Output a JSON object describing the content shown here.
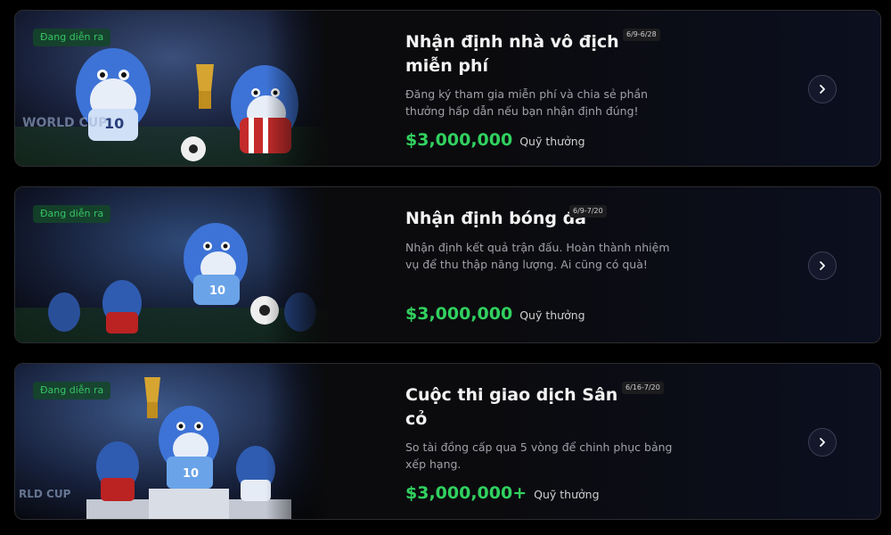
{
  "cards": [
    {
      "status": "Đang diễn ra",
      "title": "Nhận định nhà vô địch miễn phí",
      "date": "6/9-6/28",
      "description": "Đăng ký tham gia miễn phí và chia sẻ phần thưởng hấp dẫn nếu bạn nhận định đúng!",
      "prize_amount": "$3,000,000",
      "prize_label": "Quỹ thưởng",
      "icon": "chevron-right-icon",
      "image_text": "WORLD CUP"
    },
    {
      "status": "Đang diễn ra",
      "title": "Nhận định bóng đá",
      "date": "6/9-7/20",
      "description": "Nhận định kết quả trận đấu. Hoàn thành nhiệm vụ để thu thập năng lượng. Ai cũng có quà!",
      "prize_amount": "$3,000,000",
      "prize_label": "Quỹ thưởng",
      "icon": "chevron-right-icon"
    },
    {
      "status": "Đang diễn ra",
      "title": "Cuộc thi giao dịch Sân cỏ",
      "date": "6/16-7/20",
      "description": "So tài đồng cấp qua 5 vòng để chinh phục bảng xếp hạng.",
      "prize_amount": "$3,000,000+",
      "prize_label": "Quỹ thưởng",
      "icon": "chevron-right-icon",
      "image_text": "RLD CUP"
    }
  ],
  "colors": {
    "accent_green": "#31d15f",
    "badge_green": "#37c465",
    "mascot_blue": "#3d73d6",
    "card_border": "#2c2c30"
  }
}
